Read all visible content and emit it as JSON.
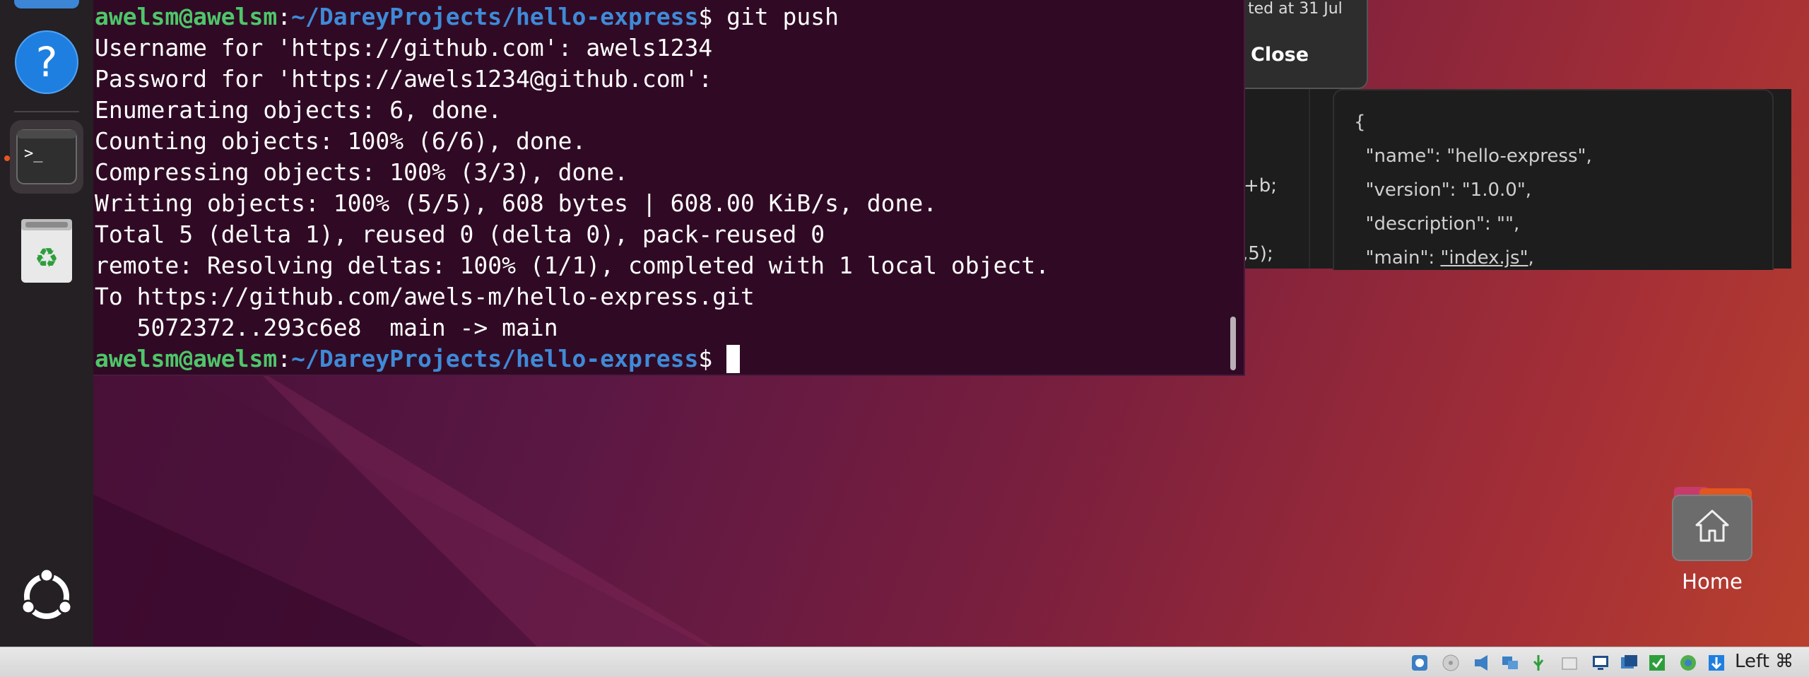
{
  "terminal": {
    "prompt_user": "awelsm@awelsm",
    "prompt_colon": ":",
    "prompt_path": "~/DareyProjects/hello-express",
    "prompt_symbol": "$",
    "command": " git push",
    "output": [
      "Username for 'https://github.com': awels1234",
      "Password for 'https://awels1234@github.com':",
      "Enumerating objects: 6, done.",
      "Counting objects: 100% (6/6), done.",
      "Compressing objects: 100% (3/3), done.",
      "Writing objects: 100% (5/5), 608 bytes | 608.00 KiB/s, done.",
      "Total 5 (delta 1), reused 0 (delta 0), pack-reused 0",
      "remote: Resolving deltas: 100% (1/1), completed with 1 local object.",
      "To https://github.com/awels-m/hello-express.git",
      "   5072372..293c6e8  main -> main"
    ]
  },
  "dialog": {
    "snippet": "ted at 31 Jul",
    "close_label": "Close"
  },
  "editor": {
    "code_fragments": [
      "+b;",
      ",5);"
    ],
    "json_lines": [
      "{",
      "  \"name\": \"hello-express\",",
      "  \"version\": \"1.0.0\",",
      "  \"description\": \"\",",
      "  \"main\": "
    ],
    "main_value": "\"index.js\"",
    "main_suffix": ","
  },
  "desktop": {
    "home_label": "Home"
  },
  "statusbar": {
    "host_key": "Left ⌘"
  },
  "colors": {
    "terminal_bg": "#300a24",
    "prompt_user": "#4ec66a",
    "prompt_path": "#3f8ad8",
    "ubuntu_orange": "#e95420"
  }
}
